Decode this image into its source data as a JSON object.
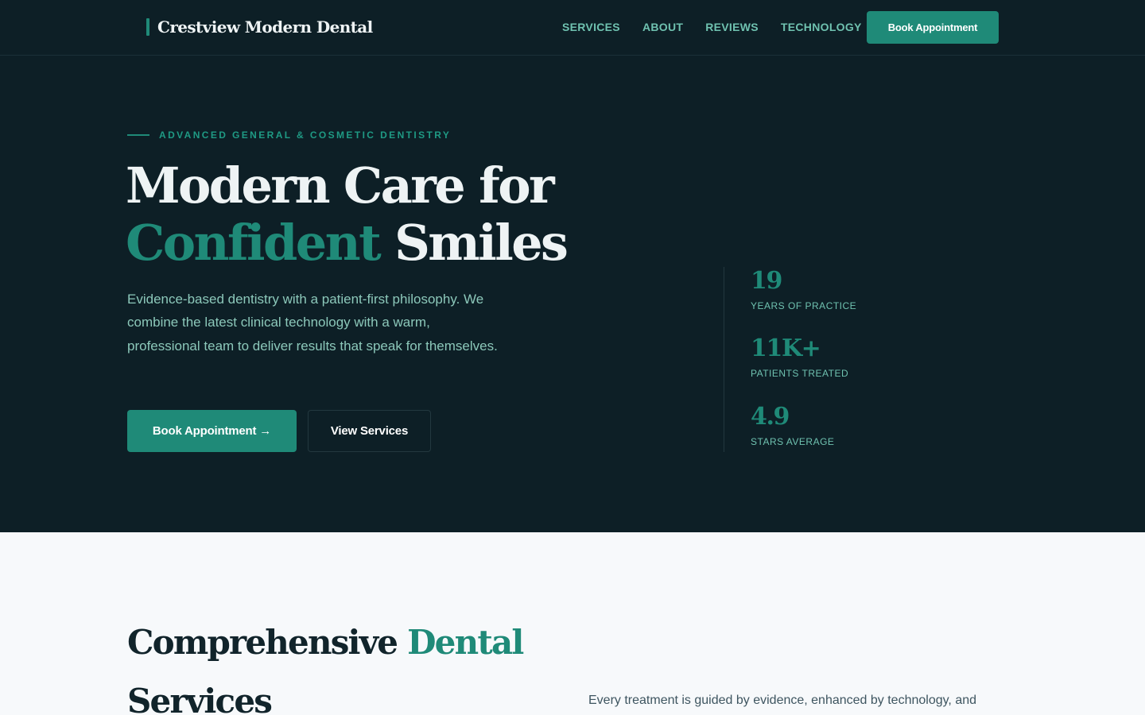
{
  "nav": {
    "brand": "Crestview Modern Dental",
    "links": [
      "SERVICES",
      "ABOUT",
      "REVIEWS",
      "TECHNOLOGY"
    ],
    "cta": "Book Appointment"
  },
  "hero": {
    "eyebrow": "ADVANCED GENERAL & COSMETIC DENTISTRY",
    "headline_line1": "Modern Care for",
    "headline_accent": "Confident",
    "headline_rest": "Smiles",
    "lede": "Evidence-based dentistry with a patient-first philosophy. We combine the latest clinical technology with a warm, professional team to deliver results that speak for themselves.",
    "primary_cta": "Book Appointment →",
    "secondary_cta": "View Services",
    "stats": [
      {
        "value": "19",
        "label": "YEARS OF PRACTICE"
      },
      {
        "value": "11K+",
        "label": "PATIENTS TREATED"
      },
      {
        "value": "4.9",
        "label": "STARS AVERAGE"
      }
    ]
  },
  "services": {
    "title_start": "Comprehensive",
    "title_accent": "Dental",
    "title_end": "Services",
    "intro": "Every treatment is guided by evidence, enhanced by technology, and"
  },
  "colors": {
    "background_dark": "#0d1f26",
    "accent": "#1f8a78",
    "accent_light": "#6fc2b0",
    "text_light": "#eef3f4",
    "section_light": "#f7f9fb"
  }
}
